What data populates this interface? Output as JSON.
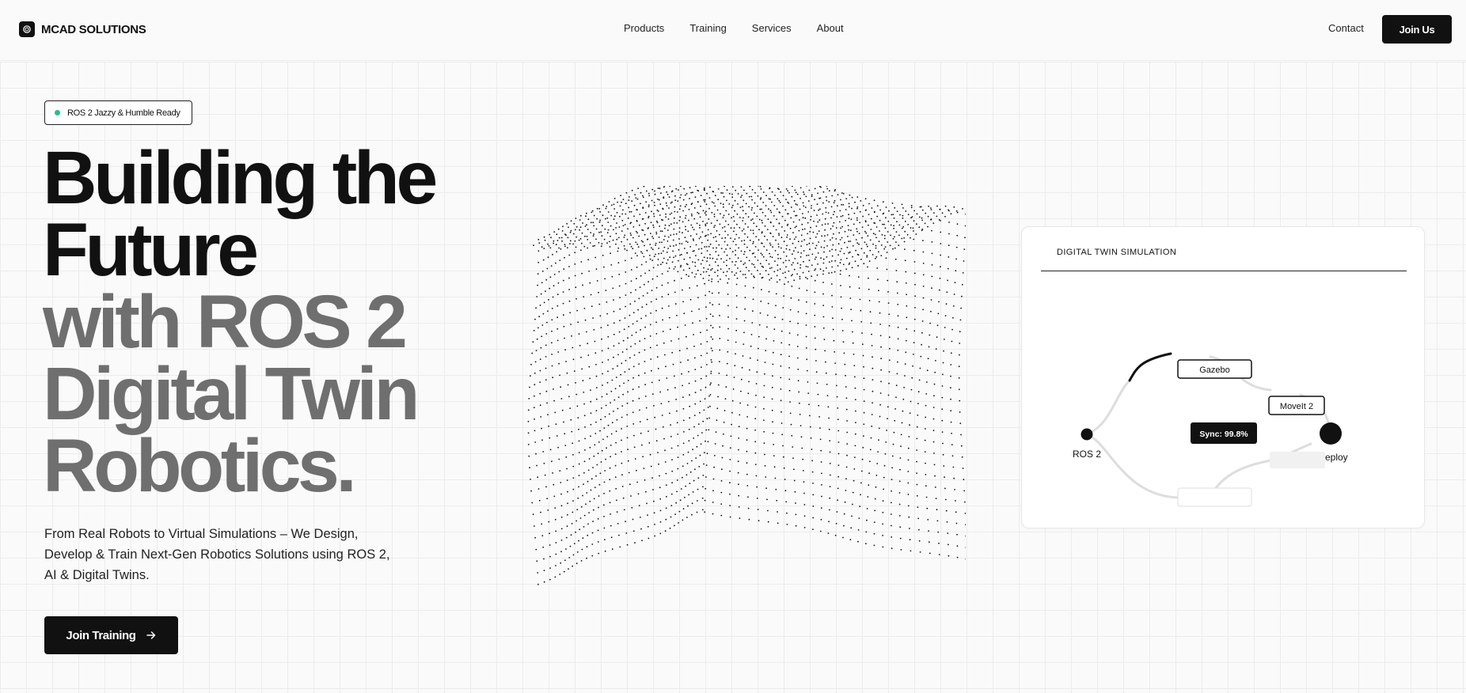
{
  "nav": {
    "logo": "MCAD SOLUTIONS",
    "links": [
      "Products",
      "Training",
      "Services",
      "About"
    ],
    "contact": "Contact",
    "join": "Join Us"
  },
  "hero": {
    "badge": "ROS 2 Jazzy & Humble Ready",
    "headline_dark": [
      "Building the",
      "Future"
    ],
    "headline_grey": [
      "with ROS 2",
      "Digital Twin",
      "Robotics."
    ],
    "subtext": [
      "From Real Robots to Virtual Simulations – We Design,",
      "Develop & Train Next-Gen Robotics Solutions using ROS 2,",
      "AI & Digital Twins."
    ],
    "cta": "Join Training"
  },
  "simulation_card": {
    "title": "DIGITAL TWIN SIMULATION",
    "nodes": {
      "source": "ROS 2",
      "gazebo": "Gazebo",
      "moveit": "MoveIt 2",
      "deploy": "Deploy"
    },
    "sync_badge": "Sync: 99.8%"
  },
  "icons": {
    "logo": "logo-mark-icon",
    "cta": "arrow-right-icon",
    "status": "status-dot-icon"
  },
  "colors": {
    "accent": "#111111",
    "muted_text": "#6f6f6f",
    "status_green": "#1fc28a"
  }
}
